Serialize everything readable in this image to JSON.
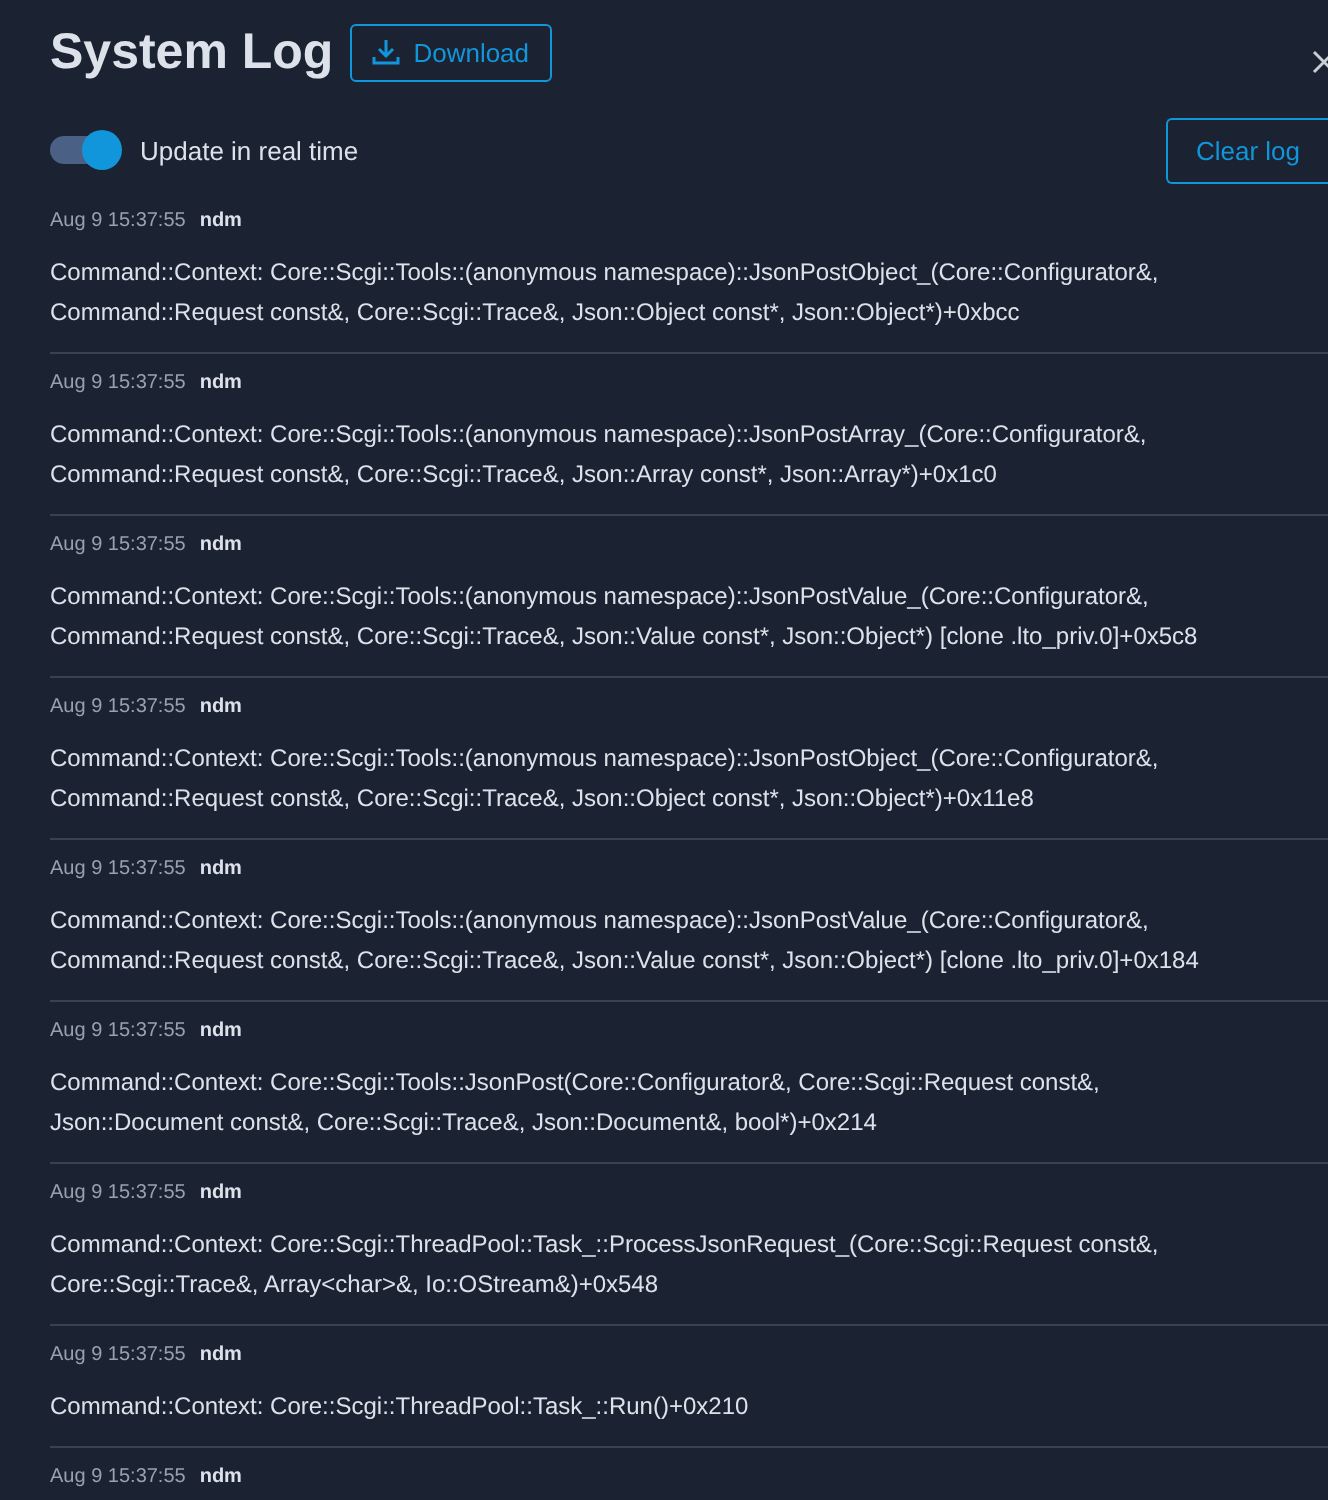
{
  "header": {
    "title": "System Log",
    "download_button": "Download"
  },
  "realtime_toggle": {
    "label": "Update in real time",
    "on": true
  },
  "clear_button": "Clear log",
  "entries": [
    {
      "time": "Aug 9 15:37:55",
      "source": "ndm",
      "message": "Command::Context: Core::Scgi::Tools::(anonymous namespace)::JsonPostObject_(Core::Configurator&, Command::Request const&, Core::Scgi::Trace&, Json::Object const*, Json::Object*)+0xbcc"
    },
    {
      "time": "Aug 9 15:37:55",
      "source": "ndm",
      "message": "Command::Context: Core::Scgi::Tools::(anonymous namespace)::JsonPostArray_(Core::Configurator&, Command::Request const&, Core::Scgi::Trace&, Json::Array const*, Json::Array*)+0x1c0"
    },
    {
      "time": "Aug 9 15:37:55",
      "source": "ndm",
      "message": "Command::Context: Core::Scgi::Tools::(anonymous namespace)::JsonPostValue_(Core::Configurator&, Command::Request const&, Core::Scgi::Trace&, Json::Value const*, Json::Object*) [clone .lto_priv.0]+0x5c8"
    },
    {
      "time": "Aug 9 15:37:55",
      "source": "ndm",
      "message": "Command::Context: Core::Scgi::Tools::(anonymous namespace)::JsonPostObject_(Core::Configurator&, Command::Request const&, Core::Scgi::Trace&, Json::Object const*, Json::Object*)+0x11e8"
    },
    {
      "time": "Aug 9 15:37:55",
      "source": "ndm",
      "message": "Command::Context: Core::Scgi::Tools::(anonymous namespace)::JsonPostValue_(Core::Configurator&, Command::Request const&, Core::Scgi::Trace&, Json::Value const*, Json::Object*) [clone .lto_priv.0]+0x184"
    },
    {
      "time": "Aug 9 15:37:55",
      "source": "ndm",
      "message": "Command::Context: Core::Scgi::Tools::JsonPost(Core::Configurator&, Core::Scgi::Request const&, Json::Document const&, Core::Scgi::Trace&, Json::Document&, bool*)+0x214"
    },
    {
      "time": "Aug 9 15:37:55",
      "source": "ndm",
      "message": "Command::Context: Core::Scgi::ThreadPool::Task_::ProcessJsonRequest_(Core::Scgi::Request const&, Core::Scgi::Trace&, Array<char>&, Io::OStream&)+0x548"
    },
    {
      "time": "Aug 9 15:37:55",
      "source": "ndm",
      "message": "Command::Context: Core::Scgi::ThreadPool::Task_::Run()+0x210"
    },
    {
      "time": "Aug 9 15:37:55",
      "source": "ndm"
    }
  ]
}
